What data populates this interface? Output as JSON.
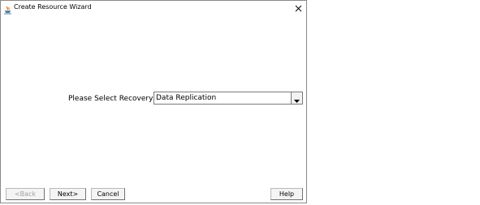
{
  "window": {
    "title": "Create Resource Wizard",
    "icon": "java-cup-icon",
    "close_icon": "close-icon"
  },
  "form": {
    "recovery_kit_label": "Please Select Recovery Kit",
    "recovery_kit_value": "Data Replication",
    "dropdown_icon": "chevron-down-icon"
  },
  "buttons": {
    "back": "<Back",
    "next": "Next>",
    "cancel": "Cancel",
    "help": "Help"
  }
}
